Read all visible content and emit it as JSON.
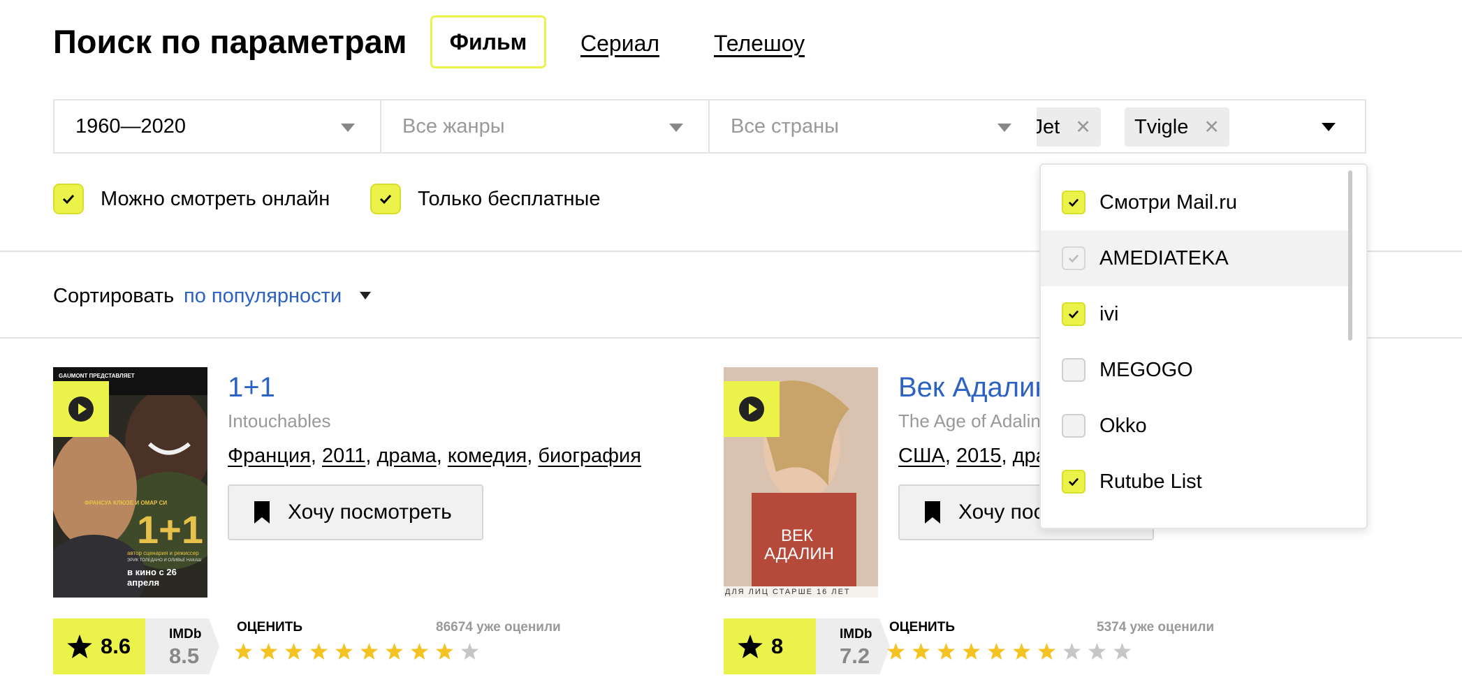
{
  "header": {
    "title": "Поиск по параметрам",
    "tabs": [
      {
        "label": "Фильм",
        "active": true
      },
      {
        "label": "Сериал",
        "active": false
      },
      {
        "label": "Телешоу",
        "active": false
      }
    ]
  },
  "filters": {
    "years": "1960—2020",
    "genres_placeholder": "Все жанры",
    "countries_placeholder": "Все страны",
    "services_chips": [
      "vJet",
      "Tvigle"
    ]
  },
  "checkboxes": [
    {
      "label": "Можно смотреть онлайн",
      "checked": true
    },
    {
      "label": "Только бесплатные",
      "checked": true
    }
  ],
  "sort": {
    "label": "Сортировать",
    "value": "по популярности"
  },
  "dropdown": {
    "items": [
      {
        "label": "Смотри Mail.ru",
        "state": "checked"
      },
      {
        "label": "AMEDIATEKA",
        "state": "disabled-checked"
      },
      {
        "label": "ivi",
        "state": "checked"
      },
      {
        "label": "MEGOGO",
        "state": "unchecked"
      },
      {
        "label": "Okko",
        "state": "unchecked"
      },
      {
        "label": "Rutube List",
        "state": "checked"
      }
    ]
  },
  "movies": [
    {
      "title": "1+1",
      "original_title": "Intouchables",
      "country": "Франция",
      "year": "2011",
      "genres": [
        "драма",
        "комедия",
        "биография"
      ],
      "watch_label": "Хочу посмотреть",
      "rating": "8.6",
      "imdb_label": "IMDb",
      "imdb_rating": "8.5",
      "rate_label": "ОЦЕНИТЬ",
      "rated_count": "86674 уже оценили",
      "stars_filled": 9,
      "stars_total": 10,
      "poster": {
        "top_line": "GAUMONT ПРЕДСТАВЛЯЕТ",
        "cast_line": "ФРАНСУА КЛЮЗЕ И ОМАР СИ",
        "title": "1+1",
        "sub": "автор сценария и режиссер",
        "directors": "ЭРИК ТОЛЕДАНО И ОЛИВЬЕ НАКАШ",
        "release": "в кино с 26 апреля"
      }
    },
    {
      "title": "Век Адалин",
      "original_title": "The Age of Adaline",
      "country": "США",
      "year": "2015",
      "genres": [
        "драма"
      ],
      "watch_label": "Хочу посмотреть",
      "rating": "8",
      "imdb_label": "IMDb",
      "imdb_rating": "7.2",
      "rate_label": "ОЦЕНИТЬ",
      "rated_count": "5374 уже оценили",
      "stars_filled": 7,
      "stars_total": 10,
      "poster": {
        "title_line1": "ВЕК",
        "title_line2": "АДАЛИН",
        "age_line": "ДЛЯ ЛИЦ СТАРШЕ 16 ЛЕТ"
      }
    }
  ],
  "colors": {
    "accent": "#ebf34a",
    "link": "#2c62c4",
    "muted": "#999999"
  },
  "icons": [
    "chevron-down-icon",
    "close-icon",
    "checkmark-icon",
    "play-icon",
    "bookmark-icon",
    "star-icon"
  ]
}
